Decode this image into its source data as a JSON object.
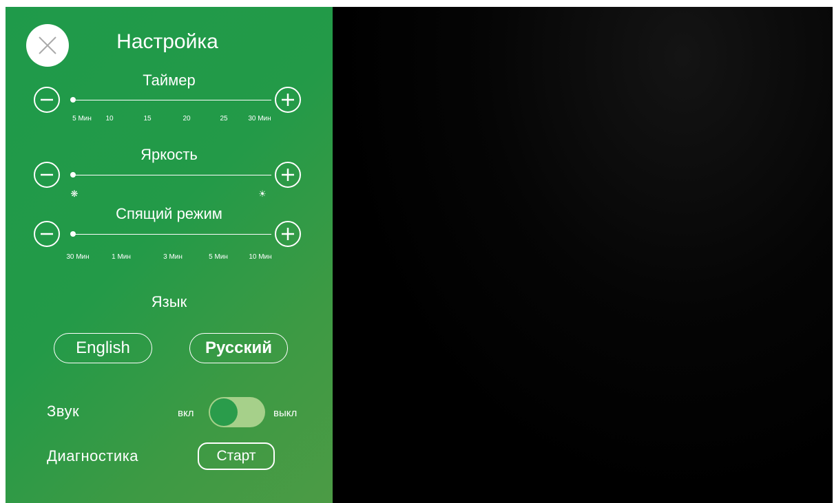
{
  "header": {
    "title": "Настройка",
    "close_icon": "close-icon"
  },
  "timer": {
    "label": "Таймер",
    "ticks": [
      "5 Мин",
      "10",
      "15",
      "20",
      "25",
      "30 Мин"
    ],
    "value": 0
  },
  "brightness": {
    "label": "Яркость",
    "low_icon": "❋",
    "high_icon": "☀",
    "value": 0
  },
  "sleep": {
    "label": "Спящий режим",
    "ticks": [
      "30 Мин",
      "1 Мин",
      "3 Мин",
      "5 Мин",
      "10 Мин"
    ],
    "value": 0
  },
  "language": {
    "label": "Язык",
    "options": [
      "English",
      "Русский"
    ],
    "selected": "Русский"
  },
  "sound": {
    "label": "Звук",
    "on_label": "вкл",
    "off_label": "выкл"
  },
  "diagnostics": {
    "label": "Диагностика",
    "start_label": "Старт"
  },
  "colors": {
    "panel_green": "#239a48",
    "toggle_track": "#a6d08a",
    "background": "#000000"
  }
}
